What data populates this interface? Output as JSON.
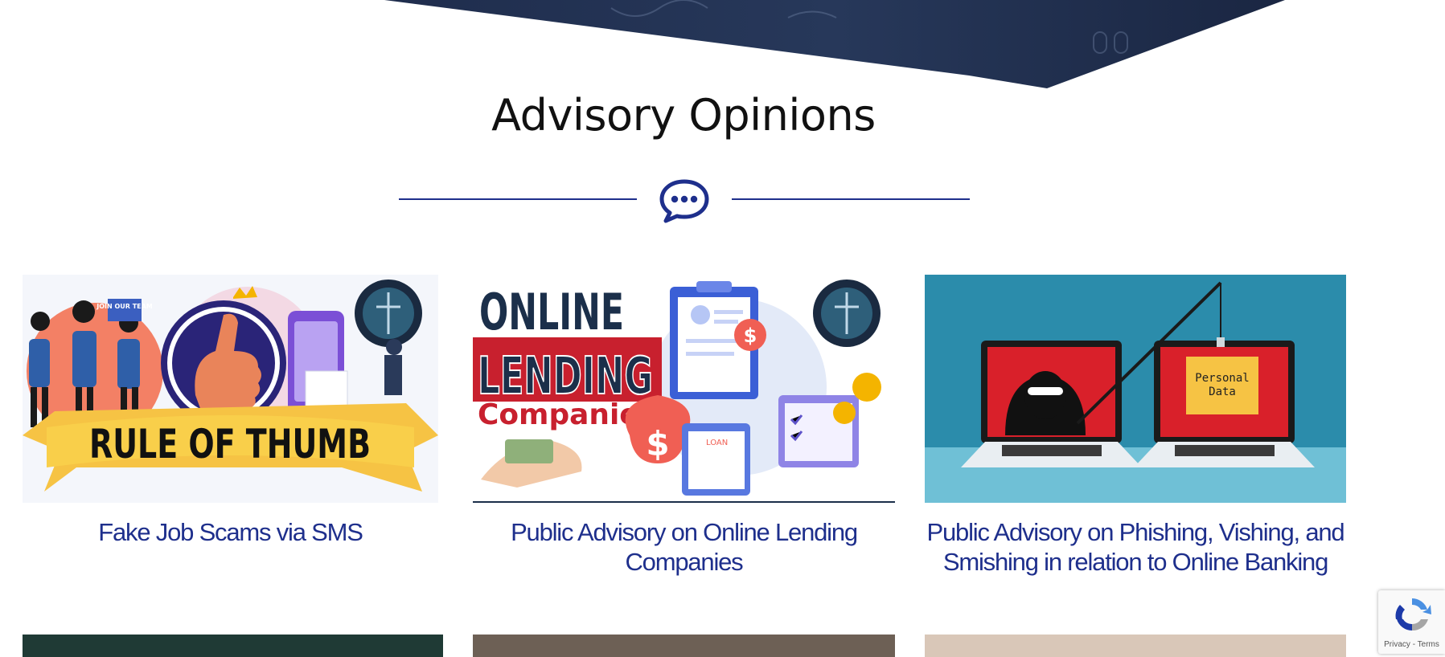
{
  "section": {
    "title": "Advisory Opinions",
    "icon": "chat-bubble-icon"
  },
  "cards": [
    {
      "title": "Fake Job Scams via SMS",
      "image_text": [
        "RULE OF THUMB",
        "JOIN OUR TEAM"
      ]
    },
    {
      "title": "Public Advisory on Online Lending Companies",
      "image_text": [
        "ONLINE",
        "LENDING",
        "Companies",
        "LOAN"
      ]
    },
    {
      "title": "Public Advisory on Phishing, Vishing, and Smishing in relation to Online Banking",
      "image_text": [
        "Personal",
        "Data"
      ]
    }
  ],
  "recaptcha": {
    "privacy": "Privacy",
    "separator": " - ",
    "terms": "Terms"
  },
  "colors": {
    "accent": "#1e2f8c",
    "hero": "#1b2a45",
    "title_text": "#111111"
  }
}
